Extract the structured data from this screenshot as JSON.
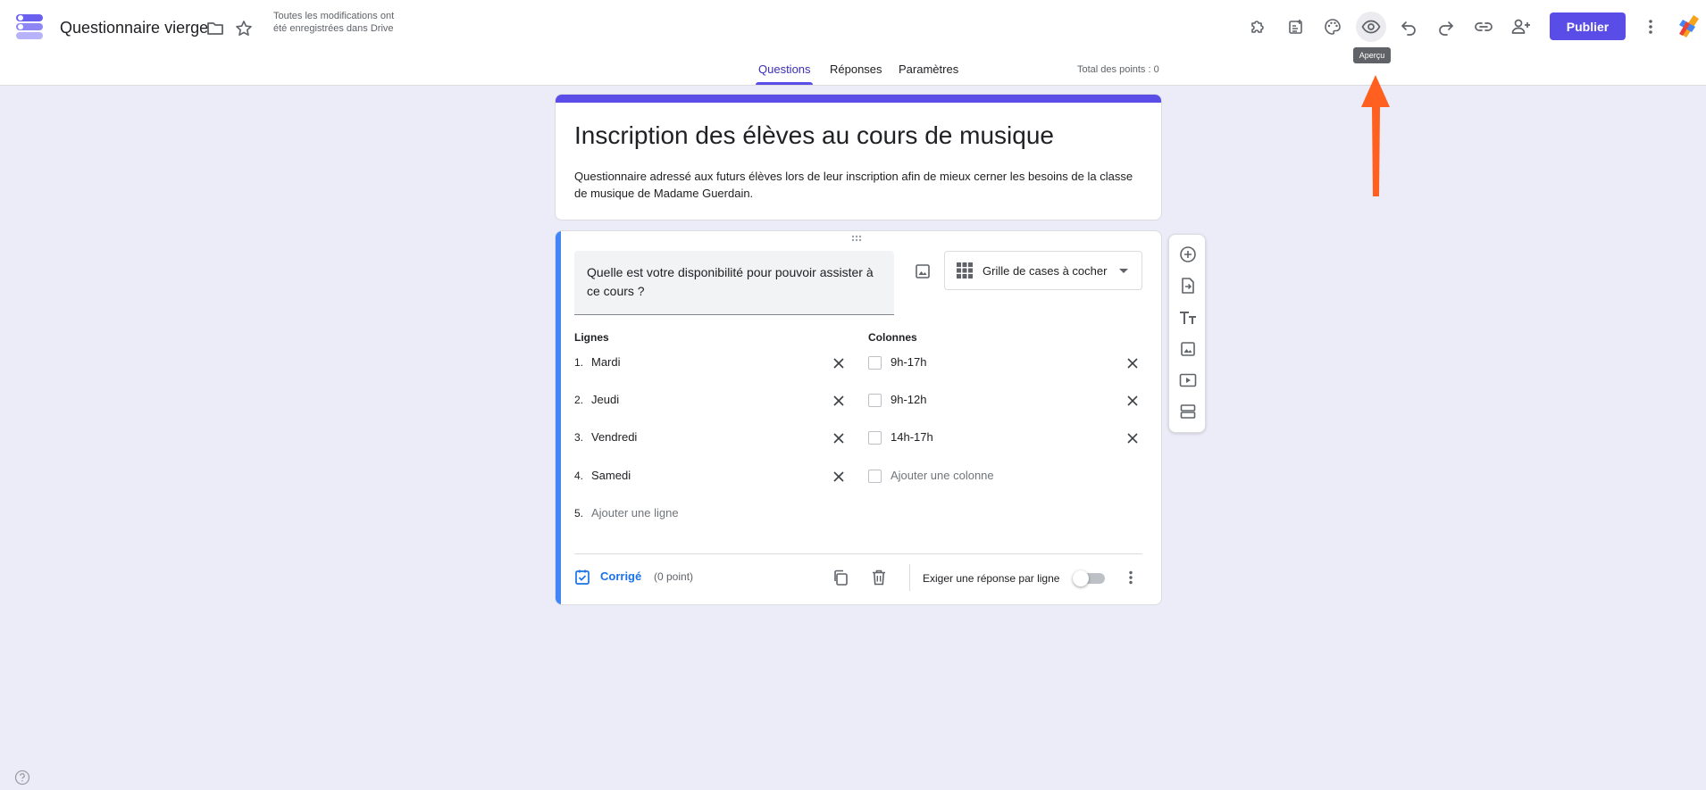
{
  "app": {
    "doc_title": "Questionnaire vierge",
    "save_status": "Toutes les modifications ont été enregistrées dans Drive",
    "publish_label": "Publier",
    "tooltip": "Aperçu"
  },
  "tabs": [
    {
      "label": "Questions",
      "active": true
    },
    {
      "label": "Réponses",
      "active": false
    },
    {
      "label": "Paramètres",
      "active": false
    }
  ],
  "total_points": "Total des points : 0",
  "form": {
    "title": "Inscription des élèves au cours de musique",
    "description": "Questionnaire adressé aux futurs élèves lors de leur inscription afin de mieux cerner les besoins de la classe de musique de Madame Guerdain."
  },
  "question": {
    "text": "Quelle est votre disponibilité pour pouvoir assister à ce cours ?",
    "type": "Grille de cases à cocher",
    "rows_heading": "Lignes",
    "cols_heading": "Colonnes",
    "rows": [
      {
        "num": "1.",
        "label": "Mardi"
      },
      {
        "num": "2.",
        "label": "Jeudi"
      },
      {
        "num": "3.",
        "label": "Vendredi"
      },
      {
        "num": "4.",
        "label": "Samedi"
      }
    ],
    "add_row": {
      "num": "5.",
      "label": "Ajouter une ligne"
    },
    "columns": [
      {
        "label": "9h-17h"
      },
      {
        "label": "9h-12h"
      },
      {
        "label": "14h-17h"
      }
    ],
    "add_column": "Ajouter une colonne",
    "answer_key_label": "Corrigé",
    "points_label": "(0 point)",
    "require_label": "Exiger une réponse par ligne",
    "require_enabled": false
  },
  "colors": {
    "accent": "#5a4ce6",
    "question_accent": "#4285f4",
    "background": "#ecebf8",
    "annotation_arrow": "#ff5f1f"
  }
}
